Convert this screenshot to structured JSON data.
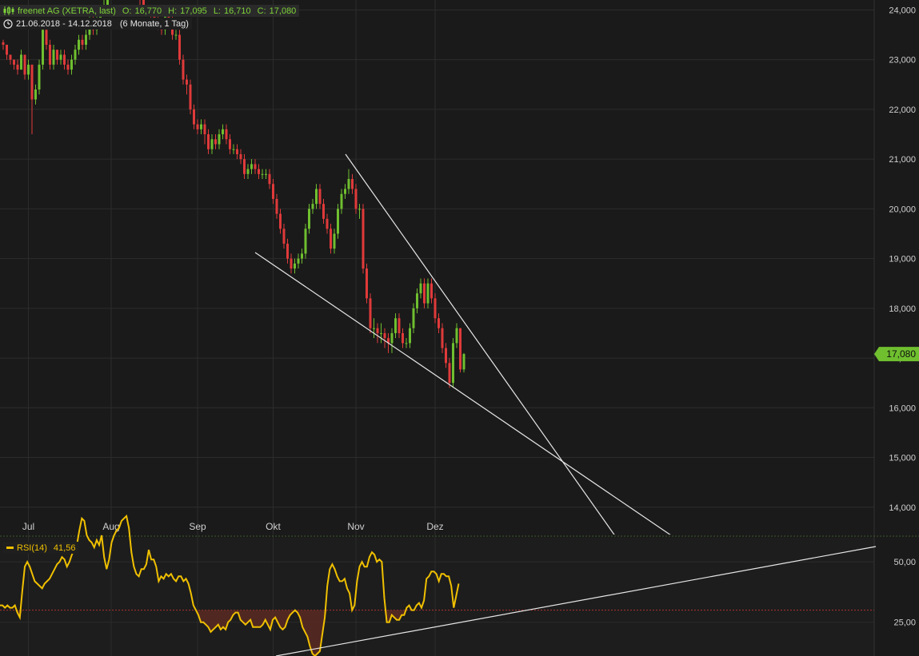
{
  "header": {
    "instrument": "freenet AG (XETRA, last)",
    "ohlc": {
      "o_label": "O:",
      "o_value": "16,770",
      "h_label": "H:",
      "h_value": "17,095",
      "l_label": "L:",
      "l_value": "16,710",
      "c_label": "C:",
      "c_value": "17,080"
    },
    "range": "21.06.2018 - 14.12.2018",
    "period": "(6 Monate, 1 Tag)"
  },
  "colors": {
    "background": "#1a1a1a",
    "up": "#6fbf2f",
    "down": "#e03a3a",
    "grid": "#2c2c2c",
    "axis_text": "#cfcfcf",
    "rsi_line": "#f0c000",
    "oversold_fill": "#5a2a22",
    "trendline": "#e6e6e6",
    "last_price_badge": "#6fbf2f"
  },
  "chart_data": [
    {
      "type": "candlestick",
      "title": "freenet AG (XETRA, last)",
      "x_tick_labels": [
        "Jul",
        "Aug",
        "Sep",
        "Okt",
        "Nov",
        "Dez"
      ],
      "y_tick_labels": [
        "24,000",
        "23,000",
        "22,000",
        "21,000",
        "20,000",
        "19,000",
        "18,000",
        "17,000",
        "16,000",
        "15,000",
        "14,000"
      ],
      "y_ticks": [
        24,
        23,
        22,
        21,
        20,
        19,
        18,
        17,
        16,
        15,
        14
      ],
      "ylim": [
        13.45,
        24.2
      ],
      "last_price": 17.08,
      "last_price_label": "17,080",
      "grid": true,
      "closes": [
        23.3,
        23.1,
        23.0,
        22.9,
        22.8,
        23.1,
        22.7,
        22.9,
        22.2,
        22.4,
        22.9,
        23.6,
        23.3,
        22.9,
        23.2,
        23.0,
        23.1,
        22.9,
        22.8,
        23.0,
        23.2,
        23.4,
        23.3,
        23.5,
        23.8,
        23.6,
        23.8,
        24.0,
        24.1,
        24.3,
        24.5,
        24.6,
        24.8,
        24.7,
        24.9,
        24.5,
        24.6,
        24.4,
        24.2,
        24.0,
        24.0,
        23.9,
        23.8,
        23.7,
        23.6,
        23.9,
        23.8,
        23.5,
        23.5,
        23.0,
        22.6,
        22.5,
        22.0,
        21.7,
        21.6,
        21.7,
        21.5,
        21.2,
        21.4,
        21.3,
        21.5,
        21.6,
        21.4,
        21.2,
        21.2,
        21.1,
        21.0,
        20.7,
        20.8,
        20.9,
        20.8,
        20.7,
        20.7,
        20.7,
        20.5,
        20.2,
        19.9,
        19.6,
        19.3,
        19.0,
        18.8,
        18.9,
        19.0,
        19.1,
        19.6,
        20.0,
        20.1,
        20.4,
        20.1,
        19.8,
        19.6,
        19.2,
        19.5,
        20.0,
        20.3,
        20.4,
        20.6,
        20.4,
        20.0,
        20.0,
        18.8,
        18.2,
        17.6,
        17.6,
        17.5,
        17.5,
        17.4,
        17.3,
        17.5,
        17.8,
        17.5,
        17.3,
        17.3,
        17.6,
        18.0,
        18.3,
        18.5,
        18.1,
        18.5,
        18.2,
        17.8,
        17.6,
        17.2,
        16.9,
        16.5,
        17.3,
        17.6,
        16.77,
        17.08
      ],
      "highs": [
        23.4,
        23.2,
        23.1,
        23.0,
        23.0,
        23.2,
        23.0,
        23.0,
        22.9,
        22.5,
        23.0,
        23.7,
        23.7,
        23.4,
        23.3,
        23.2,
        23.2,
        23.2,
        23.0,
        23.1,
        23.3,
        23.5,
        23.5,
        23.6,
        23.9,
        23.9,
        23.9,
        24.1,
        24.2,
        24.4,
        24.6,
        24.7,
        24.9,
        24.9,
        25.0,
        25.0,
        24.7,
        24.7,
        24.5,
        24.3,
        24.1,
        24.1,
        24.0,
        23.9,
        23.8,
        24.0,
        24.0,
        23.9,
        23.6,
        23.6,
        23.1,
        22.7,
        22.6,
        22.1,
        21.8,
        21.8,
        21.8,
        21.6,
        21.5,
        21.5,
        21.6,
        21.7,
        21.7,
        21.5,
        21.3,
        21.3,
        21.2,
        21.1,
        20.9,
        21.0,
        21.0,
        20.9,
        20.8,
        20.8,
        20.8,
        20.6,
        20.3,
        20.0,
        19.7,
        19.4,
        19.1,
        19.0,
        19.1,
        19.2,
        19.7,
        20.1,
        20.2,
        20.5,
        20.5,
        20.2,
        19.9,
        19.7,
        19.6,
        20.1,
        20.4,
        20.5,
        20.8,
        20.7,
        20.5,
        20.1,
        20.1,
        18.9,
        18.3,
        17.8,
        17.7,
        17.7,
        17.6,
        17.5,
        17.6,
        17.9,
        17.9,
        17.6,
        17.4,
        17.7,
        18.1,
        18.4,
        18.6,
        18.6,
        18.6,
        18.6,
        18.3,
        17.9,
        17.7,
        17.3,
        17.0,
        17.4,
        17.7,
        17.6,
        17.1
      ],
      "lows": [
        23.2,
        23.0,
        22.9,
        22.8,
        22.7,
        22.8,
        22.6,
        22.6,
        21.5,
        22.1,
        22.3,
        22.8,
        23.2,
        22.8,
        22.8,
        22.9,
        22.9,
        22.8,
        22.7,
        22.7,
        22.9,
        23.1,
        23.2,
        23.2,
        23.4,
        23.5,
        23.5,
        23.7,
        23.9,
        24.0,
        24.2,
        24.4,
        24.5,
        24.6,
        24.6,
        24.4,
        24.4,
        24.3,
        24.1,
        23.9,
        23.9,
        23.8,
        23.7,
        23.6,
        23.5,
        23.5,
        23.7,
        23.4,
        23.4,
        22.9,
        22.5,
        22.3,
        21.9,
        21.6,
        21.5,
        21.5,
        21.3,
        21.1,
        21.1,
        21.2,
        21.2,
        21.4,
        21.3,
        21.1,
        21.1,
        21.0,
        20.9,
        20.6,
        20.6,
        20.7,
        20.7,
        20.6,
        20.6,
        20.6,
        20.4,
        20.1,
        19.8,
        19.5,
        19.2,
        18.9,
        18.7,
        18.7,
        18.8,
        18.9,
        19.0,
        19.5,
        19.9,
        20.0,
        20.0,
        19.7,
        19.5,
        19.1,
        19.1,
        19.4,
        19.9,
        20.2,
        20.3,
        20.3,
        19.9,
        19.8,
        18.7,
        18.1,
        17.5,
        17.4,
        17.3,
        17.3,
        17.2,
        17.1,
        17.1,
        17.4,
        17.4,
        17.2,
        17.2,
        17.2,
        17.5,
        17.9,
        18.2,
        18.0,
        18.0,
        18.1,
        17.7,
        17.5,
        17.1,
        16.8,
        16.4,
        16.4,
        17.2,
        16.71,
        16.71
      ]
    },
    {
      "type": "line",
      "title": "RSI(14)",
      "series": [
        {
          "name": "RSI(14)",
          "last_value_label": "41,56",
          "values": [
            32,
            32,
            31,
            32,
            31,
            31,
            32,
            29,
            27,
            38,
            48,
            50,
            48,
            45,
            42,
            41,
            40,
            39,
            41,
            42,
            43,
            45,
            47,
            49,
            50,
            52,
            51,
            48,
            50,
            53,
            55,
            57,
            63,
            68,
            67,
            61,
            59,
            58,
            56,
            59,
            57,
            61,
            52,
            47,
            51,
            58,
            61,
            63,
            64,
            67,
            68,
            69,
            64,
            54,
            48,
            45,
            44,
            47,
            47,
            49,
            55,
            51,
            51,
            48,
            42,
            44,
            43,
            45,
            44,
            45,
            43,
            42,
            44,
            44,
            42,
            43,
            41,
            37,
            32,
            30,
            28,
            25,
            25,
            24,
            23,
            21,
            22,
            23,
            24,
            22,
            23,
            22,
            25,
            26,
            28,
            29,
            29,
            26,
            25,
            24,
            25,
            26,
            23,
            23,
            23,
            23,
            24,
            26,
            24,
            22,
            26,
            27,
            25,
            23,
            22,
            23,
            26,
            28,
            29,
            30,
            29,
            27,
            23,
            21,
            19,
            15,
            12,
            11,
            12,
            13,
            20,
            27,
            40,
            47,
            49,
            47,
            44,
            42,
            42,
            43,
            39,
            37,
            30,
            32,
            42,
            48,
            50,
            48,
            48,
            52,
            54,
            53,
            50,
            51,
            50,
            35,
            25,
            25,
            28,
            27,
            26,
            26,
            28,
            28,
            31,
            32,
            30,
            30,
            32,
            33,
            31,
            34,
            43,
            44,
            46,
            46,
            45,
            42,
            45,
            45,
            44,
            44,
            40,
            31,
            36,
            41
          ]
        }
      ],
      "y_tick_labels": [
        "50,00",
        "25,00"
      ],
      "y_ticks": [
        50,
        25
      ],
      "ylim": [
        11,
        60
      ],
      "reference_line": 30,
      "grid": true
    }
  ]
}
